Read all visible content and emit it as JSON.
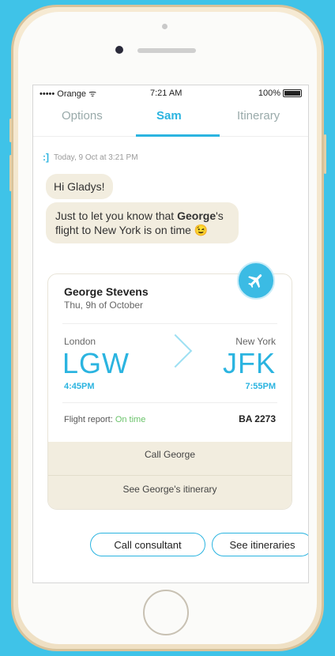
{
  "status_bar": {
    "carrier": "••••• Orange",
    "time": "7:21 AM",
    "battery": "100%"
  },
  "tabs": [
    {
      "label": "Options"
    },
    {
      "label": "Sam"
    },
    {
      "label": "Itinerary"
    }
  ],
  "conversation": {
    "timestamp": "Today, 9 Oct at 3:21 PM",
    "messages": [
      {
        "text": "Hi Gladys!"
      },
      {
        "text_pre": "Just to let you know that ",
        "text_bold": "George",
        "text_post": "'s flight to New York is on time",
        "emoji": "😉"
      }
    ]
  },
  "flight_card": {
    "passenger": "George Stevens",
    "date": "Thu, 9h of October",
    "origin": {
      "city": "London",
      "code": "LGW",
      "time": "4:45PM"
    },
    "destination": {
      "city": "New York",
      "code": "JFK",
      "time": "7:55PM"
    },
    "report_label": "Flight report:",
    "report_status": "On time",
    "flight_number": "BA 2273",
    "actions": [
      {
        "label": "Call George"
      },
      {
        "label": "See George's itinerary"
      }
    ]
  },
  "quick_replies": [
    {
      "label": "Call consultant"
    },
    {
      "label": "See itineraries"
    }
  ],
  "colors": {
    "accent": "#2bb4e0",
    "bubble": "#f2eddf",
    "success": "#6ac36a",
    "background": "#3fc3e8"
  }
}
